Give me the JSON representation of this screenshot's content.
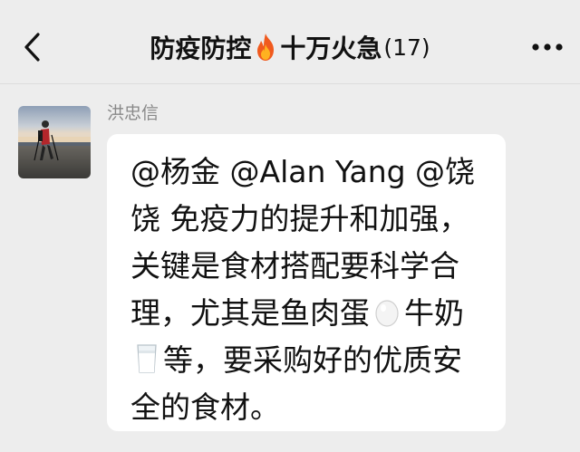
{
  "header": {
    "title": "防疫防控",
    "title_suffix": "十万火急",
    "member_count": "(17)",
    "icons": {
      "back": "chevron-left-icon",
      "fire": "fire-emoji",
      "more": "more-dots-icon"
    }
  },
  "message": {
    "sender_name": "洪忠信",
    "avatar": "avatar-photo-hiker",
    "text_part1": "@杨金 @Alan Yang @饶饶 免疫力的提升和加强，关键是食材搭配要科学合理，尤其是鱼肉蛋",
    "emoji_egg": "egg-emoji",
    "text_part2": "牛奶",
    "emoji_milk": "milk-glass-emoji",
    "text_part3": "等，要采购好的优质安全的食材。"
  }
}
